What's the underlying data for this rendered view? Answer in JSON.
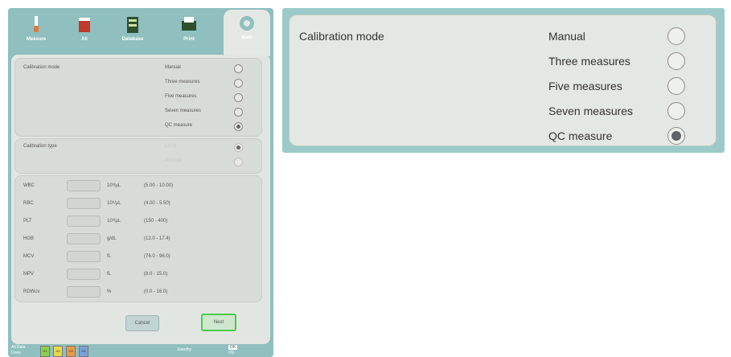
{
  "device": {
    "tabs": [
      {
        "label": "Measure",
        "icon": "test-tube-icon"
      },
      {
        "label": "All",
        "icon": "tube-rack-icon"
      },
      {
        "label": "Database",
        "icon": "database-icon"
      },
      {
        "label": "Print",
        "icon": "printer-icon"
      },
      {
        "label": "Main",
        "icon": "gear-icon"
      }
    ],
    "calibration_mode": {
      "label": "Calibration mode",
      "options": [
        "Manual",
        "Three measures",
        "Five measures",
        "Seven measures",
        "QC measure"
      ],
      "selected": "QC measure"
    },
    "calibration_type": {
      "label": "Calibration type",
      "options": [
        "Local",
        "Remote"
      ],
      "selected": "Local",
      "disabled": true
    },
    "parameters": [
      {
        "name": "WBC",
        "unit": "10³/µL",
        "range": "(5.00 - 10.00)"
      },
      {
        "name": "RBC",
        "unit": "10⁶/µL",
        "range": "(4.00 - 5.50)"
      },
      {
        "name": "PLT",
        "unit": "10³/µL",
        "range": "(150 - 400)"
      },
      {
        "name": "HGB",
        "unit": "g/dL",
        "range": "(12.0 - 17.4)"
      },
      {
        "name": "MCV",
        "unit": "fL",
        "range": "(76.0 - 96.0)"
      },
      {
        "name": "MPV",
        "unit": "fL",
        "range": "(8.0 - 15.0)"
      },
      {
        "name": "RDWcv",
        "unit": "%",
        "range": "(0.0 - 16.0)"
      }
    ],
    "buttons": {
      "cancel": "Cancel",
      "next": "Next"
    },
    "status": {
      "left": "All Data",
      "left2": "Done",
      "chips": [
        "H1",
        "H2",
        "H3",
        "H4"
      ],
      "center": "Standby",
      "right": "OK",
      "right2": "0%"
    }
  },
  "zoom": {
    "label": "Calibration mode",
    "options": [
      "Manual",
      "Three measures",
      "Five measures",
      "Seven measures",
      "QC measure"
    ],
    "selected": "QC measure"
  },
  "colors": {
    "frame": "#8fbfbf",
    "panel": "#e2e6e2",
    "accent_green": "#4bc94b"
  }
}
